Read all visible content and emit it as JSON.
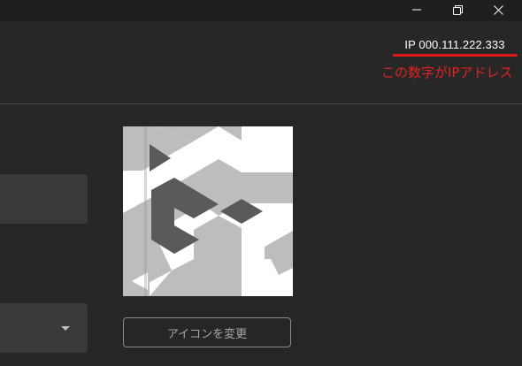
{
  "window": {
    "minimize_icon": "minimize-icon",
    "maximize_icon": "maximize-icon",
    "close_icon": "close-icon"
  },
  "header": {
    "ip_text": "IP 000.111.222.333",
    "annotation": "この数字がIPアドレス",
    "annotation_color": "#e32222",
    "underline_color": "#e01919"
  },
  "profile": {
    "change_icon_label": "アイコンを変更",
    "select_icon": "chevron-down-icon"
  }
}
